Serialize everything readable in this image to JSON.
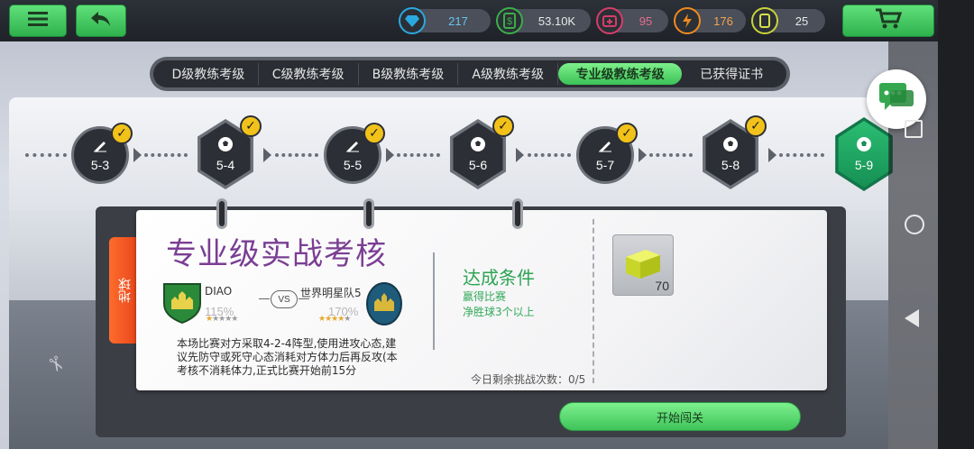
{
  "topbar": {
    "menu_icon": "hamburger-icon",
    "back_icon": "back-arrow-icon",
    "cart_icon": "cart-icon",
    "resources": [
      {
        "icon": "diamond-icon",
        "value": "217",
        "color": "#2aa9e0"
      },
      {
        "icon": "cash-icon",
        "value": "53.10K",
        "color": "#3cae4a"
      },
      {
        "icon": "medkit-icon",
        "value": "95",
        "color": "#d63d6a"
      },
      {
        "icon": "energy-icon",
        "value": "176",
        "color": "#f08a1e"
      },
      {
        "icon": "card-icon",
        "value": "25",
        "color": "#c9d23a"
      }
    ]
  },
  "tabs": [
    {
      "label": "D级教练考级",
      "active": false
    },
    {
      "label": "C级教练考级",
      "active": false
    },
    {
      "label": "B级教练考级",
      "active": false
    },
    {
      "label": "A级教练考级",
      "active": false
    },
    {
      "label": "专业级教练考级",
      "active": true
    },
    {
      "label": "已获得证书",
      "active": false
    }
  ],
  "levels": [
    {
      "label": "5-3",
      "kind": "training",
      "done": true
    },
    {
      "label": "5-4",
      "kind": "match",
      "done": true
    },
    {
      "label": "5-5",
      "kind": "training",
      "done": true
    },
    {
      "label": "5-6",
      "kind": "match",
      "done": true
    },
    {
      "label": "5-7",
      "kind": "training",
      "done": true
    },
    {
      "label": "5-8",
      "kind": "match",
      "done": true
    },
    {
      "label": "5-9",
      "kind": "match",
      "done": false,
      "current": true
    }
  ],
  "card": {
    "side_tab": "地球",
    "title": "专业级实战考核",
    "home_team": {
      "name": "DIAO",
      "pct": "115%",
      "stars": 1
    },
    "vs": "VS",
    "away_team": {
      "name": "世界明星队5",
      "pct": "170%",
      "stars": 4
    },
    "description": "本场比赛对方采取4-2-4阵型,使用进攻心态,建议先防守或死守心态消耗对方体力后再反攻(本考核不消耗体力,正式比赛开始前15分",
    "conditions_title": "达成条件",
    "conditions": [
      "赢得比赛",
      "净胜球3个以上"
    ],
    "remaining": "今日剩余挑战次数：0/5",
    "reward_count": "70",
    "reward_icon": "yellow-box-icon",
    "start_label": "开始闯关"
  },
  "chat_icon": "chat-bubble-icon"
}
